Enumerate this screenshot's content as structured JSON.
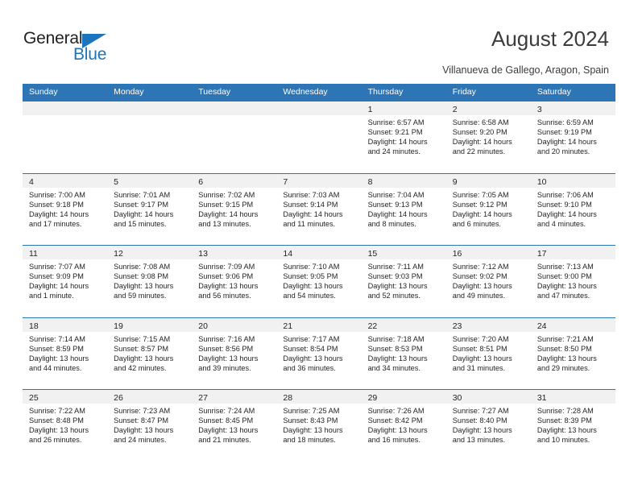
{
  "brand": {
    "name_part1": "General",
    "name_part2": "Blue"
  },
  "header": {
    "title": "August 2024",
    "subtitle": "Villanueva de Gallego, Aragon, Spain"
  },
  "colors": {
    "header_blue": "#2e75b6",
    "brand_blue": "#1c75bc",
    "day_band_gray": "#f1f1f1",
    "text": "#231f20"
  },
  "weekdays": [
    "Sunday",
    "Monday",
    "Tuesday",
    "Wednesday",
    "Thursday",
    "Friday",
    "Saturday"
  ],
  "weeks": [
    [
      {
        "day": "",
        "sunrise": "",
        "sunset": "",
        "daylight1": "",
        "daylight2": ""
      },
      {
        "day": "",
        "sunrise": "",
        "sunset": "",
        "daylight1": "",
        "daylight2": ""
      },
      {
        "day": "",
        "sunrise": "",
        "sunset": "",
        "daylight1": "",
        "daylight2": ""
      },
      {
        "day": "",
        "sunrise": "",
        "sunset": "",
        "daylight1": "",
        "daylight2": ""
      },
      {
        "day": "1",
        "sunrise": "Sunrise: 6:57 AM",
        "sunset": "Sunset: 9:21 PM",
        "daylight1": "Daylight: 14 hours",
        "daylight2": "and 24 minutes."
      },
      {
        "day": "2",
        "sunrise": "Sunrise: 6:58 AM",
        "sunset": "Sunset: 9:20 PM",
        "daylight1": "Daylight: 14 hours",
        "daylight2": "and 22 minutes."
      },
      {
        "day": "3",
        "sunrise": "Sunrise: 6:59 AM",
        "sunset": "Sunset: 9:19 PM",
        "daylight1": "Daylight: 14 hours",
        "daylight2": "and 20 minutes."
      }
    ],
    [
      {
        "day": "4",
        "sunrise": "Sunrise: 7:00 AM",
        "sunset": "Sunset: 9:18 PM",
        "daylight1": "Daylight: 14 hours",
        "daylight2": "and 17 minutes."
      },
      {
        "day": "5",
        "sunrise": "Sunrise: 7:01 AM",
        "sunset": "Sunset: 9:17 PM",
        "daylight1": "Daylight: 14 hours",
        "daylight2": "and 15 minutes."
      },
      {
        "day": "6",
        "sunrise": "Sunrise: 7:02 AM",
        "sunset": "Sunset: 9:15 PM",
        "daylight1": "Daylight: 14 hours",
        "daylight2": "and 13 minutes."
      },
      {
        "day": "7",
        "sunrise": "Sunrise: 7:03 AM",
        "sunset": "Sunset: 9:14 PM",
        "daylight1": "Daylight: 14 hours",
        "daylight2": "and 11 minutes."
      },
      {
        "day": "8",
        "sunrise": "Sunrise: 7:04 AM",
        "sunset": "Sunset: 9:13 PM",
        "daylight1": "Daylight: 14 hours",
        "daylight2": "and 8 minutes."
      },
      {
        "day": "9",
        "sunrise": "Sunrise: 7:05 AM",
        "sunset": "Sunset: 9:12 PM",
        "daylight1": "Daylight: 14 hours",
        "daylight2": "and 6 minutes."
      },
      {
        "day": "10",
        "sunrise": "Sunrise: 7:06 AM",
        "sunset": "Sunset: 9:10 PM",
        "daylight1": "Daylight: 14 hours",
        "daylight2": "and 4 minutes."
      }
    ],
    [
      {
        "day": "11",
        "sunrise": "Sunrise: 7:07 AM",
        "sunset": "Sunset: 9:09 PM",
        "daylight1": "Daylight: 14 hours",
        "daylight2": "and 1 minute."
      },
      {
        "day": "12",
        "sunrise": "Sunrise: 7:08 AM",
        "sunset": "Sunset: 9:08 PM",
        "daylight1": "Daylight: 13 hours",
        "daylight2": "and 59 minutes."
      },
      {
        "day": "13",
        "sunrise": "Sunrise: 7:09 AM",
        "sunset": "Sunset: 9:06 PM",
        "daylight1": "Daylight: 13 hours",
        "daylight2": "and 56 minutes."
      },
      {
        "day": "14",
        "sunrise": "Sunrise: 7:10 AM",
        "sunset": "Sunset: 9:05 PM",
        "daylight1": "Daylight: 13 hours",
        "daylight2": "and 54 minutes."
      },
      {
        "day": "15",
        "sunrise": "Sunrise: 7:11 AM",
        "sunset": "Sunset: 9:03 PM",
        "daylight1": "Daylight: 13 hours",
        "daylight2": "and 52 minutes."
      },
      {
        "day": "16",
        "sunrise": "Sunrise: 7:12 AM",
        "sunset": "Sunset: 9:02 PM",
        "daylight1": "Daylight: 13 hours",
        "daylight2": "and 49 minutes."
      },
      {
        "day": "17",
        "sunrise": "Sunrise: 7:13 AM",
        "sunset": "Sunset: 9:00 PM",
        "daylight1": "Daylight: 13 hours",
        "daylight2": "and 47 minutes."
      }
    ],
    [
      {
        "day": "18",
        "sunrise": "Sunrise: 7:14 AM",
        "sunset": "Sunset: 8:59 PM",
        "daylight1": "Daylight: 13 hours",
        "daylight2": "and 44 minutes."
      },
      {
        "day": "19",
        "sunrise": "Sunrise: 7:15 AM",
        "sunset": "Sunset: 8:57 PM",
        "daylight1": "Daylight: 13 hours",
        "daylight2": "and 42 minutes."
      },
      {
        "day": "20",
        "sunrise": "Sunrise: 7:16 AM",
        "sunset": "Sunset: 8:56 PM",
        "daylight1": "Daylight: 13 hours",
        "daylight2": "and 39 minutes."
      },
      {
        "day": "21",
        "sunrise": "Sunrise: 7:17 AM",
        "sunset": "Sunset: 8:54 PM",
        "daylight1": "Daylight: 13 hours",
        "daylight2": "and 36 minutes."
      },
      {
        "day": "22",
        "sunrise": "Sunrise: 7:18 AM",
        "sunset": "Sunset: 8:53 PM",
        "daylight1": "Daylight: 13 hours",
        "daylight2": "and 34 minutes."
      },
      {
        "day": "23",
        "sunrise": "Sunrise: 7:20 AM",
        "sunset": "Sunset: 8:51 PM",
        "daylight1": "Daylight: 13 hours",
        "daylight2": "and 31 minutes."
      },
      {
        "day": "24",
        "sunrise": "Sunrise: 7:21 AM",
        "sunset": "Sunset: 8:50 PM",
        "daylight1": "Daylight: 13 hours",
        "daylight2": "and 29 minutes."
      }
    ],
    [
      {
        "day": "25",
        "sunrise": "Sunrise: 7:22 AM",
        "sunset": "Sunset: 8:48 PM",
        "daylight1": "Daylight: 13 hours",
        "daylight2": "and 26 minutes."
      },
      {
        "day": "26",
        "sunrise": "Sunrise: 7:23 AM",
        "sunset": "Sunset: 8:47 PM",
        "daylight1": "Daylight: 13 hours",
        "daylight2": "and 24 minutes."
      },
      {
        "day": "27",
        "sunrise": "Sunrise: 7:24 AM",
        "sunset": "Sunset: 8:45 PM",
        "daylight1": "Daylight: 13 hours",
        "daylight2": "and 21 minutes."
      },
      {
        "day": "28",
        "sunrise": "Sunrise: 7:25 AM",
        "sunset": "Sunset: 8:43 PM",
        "daylight1": "Daylight: 13 hours",
        "daylight2": "and 18 minutes."
      },
      {
        "day": "29",
        "sunrise": "Sunrise: 7:26 AM",
        "sunset": "Sunset: 8:42 PM",
        "daylight1": "Daylight: 13 hours",
        "daylight2": "and 16 minutes."
      },
      {
        "day": "30",
        "sunrise": "Sunrise: 7:27 AM",
        "sunset": "Sunset: 8:40 PM",
        "daylight1": "Daylight: 13 hours",
        "daylight2": "and 13 minutes."
      },
      {
        "day": "31",
        "sunrise": "Sunrise: 7:28 AM",
        "sunset": "Sunset: 8:39 PM",
        "daylight1": "Daylight: 13 hours",
        "daylight2": "and 10 minutes."
      }
    ]
  ]
}
